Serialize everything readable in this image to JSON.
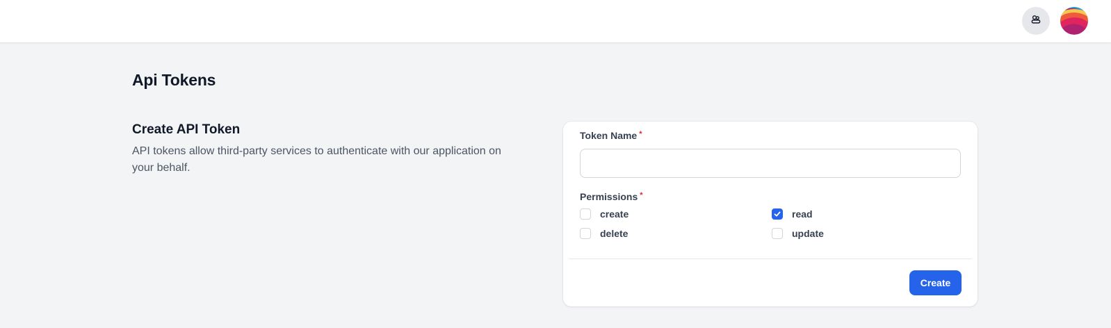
{
  "header": {
    "team_icon": "users-icon",
    "avatar_icon": "user-avatar"
  },
  "page": {
    "title": "Api Tokens"
  },
  "section": {
    "heading": "Create API Token",
    "description": "API tokens allow third-party services to authenticate with our application on your behalf."
  },
  "form": {
    "token_name_label": "Token Name",
    "required_mark": "*",
    "token_name_value": "",
    "token_name_placeholder": "",
    "permissions_label": "Permissions",
    "permissions": [
      {
        "label": "create",
        "checked": false
      },
      {
        "label": "read",
        "checked": true
      },
      {
        "label": "delete",
        "checked": false
      },
      {
        "label": "update",
        "checked": false
      }
    ],
    "submit_label": "Create"
  },
  "colors": {
    "accent": "#2563eb",
    "required": "#dc2626",
    "background": "#f3f4f6"
  }
}
